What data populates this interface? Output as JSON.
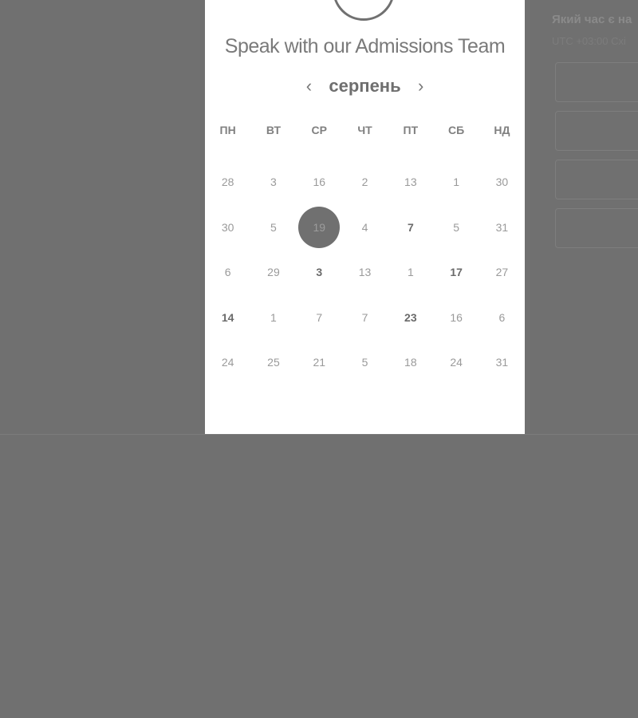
{
  "scheduler": {
    "title": "Speak with our Admissions Team",
    "month": "серпень",
    "prev_icon": "chevron-left-icon",
    "next_icon": "chevron-right-icon",
    "weekdays": [
      "ПН",
      "ВТ",
      "СР",
      "ЧТ",
      "ПТ",
      "СБ",
      "НД"
    ],
    "weeks": [
      [
        "28",
        "3",
        "16",
        "2",
        "13",
        "1",
        "30"
      ],
      [
        "30",
        "5",
        "19",
        "4",
        "7",
        "5",
        "31"
      ],
      [
        "6",
        "29",
        "3",
        "13",
        "1",
        "17",
        "27"
      ],
      [
        "14",
        "1",
        "7",
        "7",
        "23",
        "16",
        "6"
      ],
      [
        "24",
        "25",
        "21",
        "5",
        "18",
        "24",
        "31"
      ]
    ],
    "selected_day": "19"
  },
  "time_panel": {
    "question": "Який час є на",
    "timezone": "UTC +03:00 Схі"
  },
  "colors": {
    "overlay": "#707070",
    "card": "#ffffff",
    "selected": "#707070"
  }
}
